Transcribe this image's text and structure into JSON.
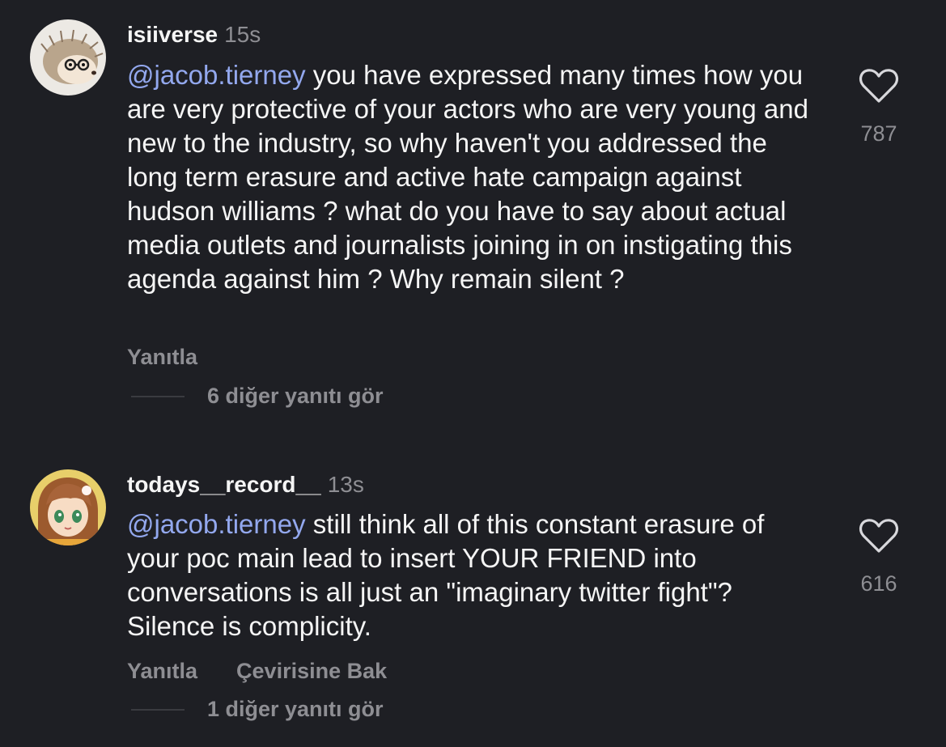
{
  "comments": [
    {
      "username": "isiiverse",
      "time": "15s",
      "mention": "@jacob.tierney",
      "text": " you have expressed many times how you are very protective of your actors who are very young and new to the industry, so why haven't you addressed the long term erasure and active hate campaign against hudson williams ? what do you have to say about actual media outlets and journalists joining in on instigating this agenda against him ? Why remain silent ?",
      "reply_label": "Yanıtla",
      "view_replies": "6 diğer yanıtı gör",
      "likes": "787",
      "avatar": "hedgehog-with-glasses"
    },
    {
      "username": "todays__record__",
      "time": "13s",
      "mention": "@jacob.tierney",
      "text": " still think all of this constant erasure of your poc main lead to insert YOUR FRIEND into conversations is all just an \"imaginary twitter fight\"? Silence is complicity.",
      "reply_label": "Yanıtla",
      "translate_label": "Çevirisine Bak",
      "view_replies": "1 diğer yanıtı gör",
      "likes": "616",
      "avatar": "anime-girl"
    }
  ],
  "colors": {
    "background": "#1e1f24",
    "mention": "#93a8ee",
    "secondary": "#8e8e93",
    "text": "#f5f5f5"
  },
  "icons": {
    "like": "heart-outline-icon"
  }
}
